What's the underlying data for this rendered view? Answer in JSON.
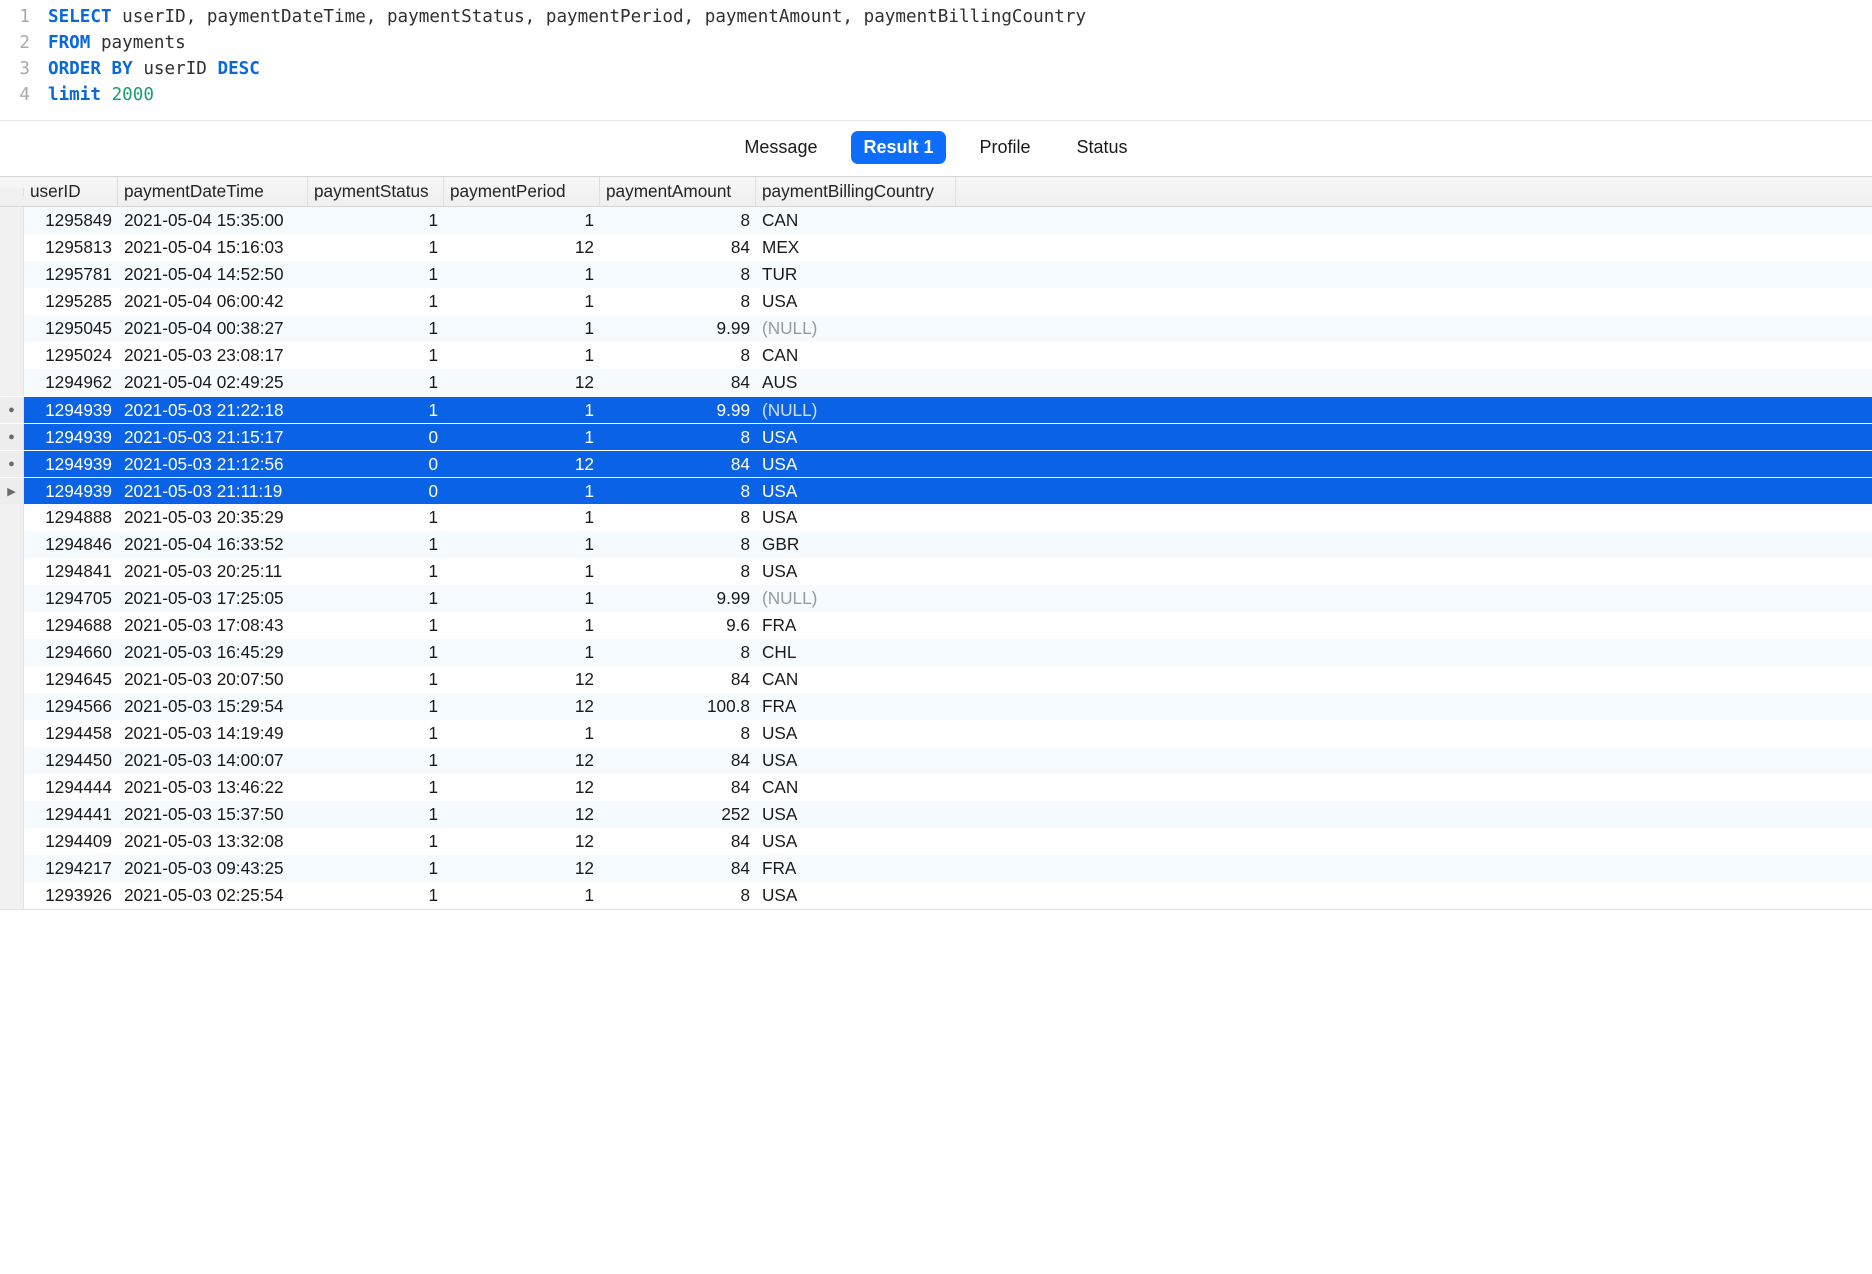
{
  "sql": {
    "lines": [
      {
        "n": "1",
        "tokens": [
          {
            "t": "SELECT",
            "c": "kw"
          },
          {
            "t": " ",
            "c": ""
          },
          {
            "t": "userID, paymentDateTime, paymentStatus, paymentPeriod, paymentAmount, paymentBillingCountry",
            "c": "ident"
          }
        ]
      },
      {
        "n": "2",
        "tokens": [
          {
            "t": "FROM",
            "c": "kw"
          },
          {
            "t": " ",
            "c": ""
          },
          {
            "t": "payments",
            "c": "ident"
          }
        ]
      },
      {
        "n": "3",
        "tokens": [
          {
            "t": "ORDER BY",
            "c": "kw"
          },
          {
            "t": " ",
            "c": ""
          },
          {
            "t": "userID ",
            "c": "ident"
          },
          {
            "t": "DESC",
            "c": "kw"
          }
        ]
      },
      {
        "n": "4",
        "tokens": [
          {
            "t": "limit",
            "c": "kw"
          },
          {
            "t": " ",
            "c": ""
          },
          {
            "t": "2000",
            "c": "num"
          }
        ]
      }
    ]
  },
  "tabs": [
    {
      "label": "Message",
      "active": false
    },
    {
      "label": "Result 1",
      "active": true
    },
    {
      "label": "Profile",
      "active": false
    },
    {
      "label": "Status",
      "active": false
    }
  ],
  "columns": [
    "userID",
    "paymentDateTime",
    "paymentStatus",
    "paymentPeriod",
    "paymentAmount",
    "paymentBillingCountry"
  ],
  "null_label": "(NULL)",
  "rows": [
    {
      "mark": "",
      "sel": false,
      "userID": "1295849",
      "dt": "2021-05-04 15:35:00",
      "status": "1",
      "period": "1",
      "amount": "8",
      "country": "CAN"
    },
    {
      "mark": "",
      "sel": false,
      "userID": "1295813",
      "dt": "2021-05-04 15:16:03",
      "status": "1",
      "period": "12",
      "amount": "84",
      "country": "MEX"
    },
    {
      "mark": "",
      "sel": false,
      "userID": "1295781",
      "dt": "2021-05-04 14:52:50",
      "status": "1",
      "period": "1",
      "amount": "8",
      "country": "TUR"
    },
    {
      "mark": "",
      "sel": false,
      "userID": "1295285",
      "dt": "2021-05-04 06:00:42",
      "status": "1",
      "period": "1",
      "amount": "8",
      "country": "USA"
    },
    {
      "mark": "",
      "sel": false,
      "userID": "1295045",
      "dt": "2021-05-04 00:38:27",
      "status": "1",
      "period": "1",
      "amount": "9.99",
      "country": null
    },
    {
      "mark": "",
      "sel": false,
      "userID": "1295024",
      "dt": "2021-05-03 23:08:17",
      "status": "1",
      "period": "1",
      "amount": "8",
      "country": "CAN"
    },
    {
      "mark": "",
      "sel": false,
      "userID": "1294962",
      "dt": "2021-05-04 02:49:25",
      "status": "1",
      "period": "12",
      "amount": "84",
      "country": "AUS"
    },
    {
      "mark": "dot",
      "sel": true,
      "userID": "1294939",
      "dt": "2021-05-03 21:22:18",
      "status": "1",
      "period": "1",
      "amount": "9.99",
      "country": null
    },
    {
      "mark": "dot",
      "sel": true,
      "userID": "1294939",
      "dt": "2021-05-03 21:15:17",
      "status": "0",
      "period": "1",
      "amount": "8",
      "country": "USA"
    },
    {
      "mark": "dot",
      "sel": true,
      "userID": "1294939",
      "dt": "2021-05-03 21:12:56",
      "status": "0",
      "period": "12",
      "amount": "84",
      "country": "USA"
    },
    {
      "mark": "tri",
      "sel": true,
      "userID": "1294939",
      "dt": "2021-05-03 21:11:19",
      "status": "0",
      "period": "1",
      "amount": "8",
      "country": "USA"
    },
    {
      "mark": "",
      "sel": false,
      "userID": "1294888",
      "dt": "2021-05-03 20:35:29",
      "status": "1",
      "period": "1",
      "amount": "8",
      "country": "USA"
    },
    {
      "mark": "",
      "sel": false,
      "userID": "1294846",
      "dt": "2021-05-04 16:33:52",
      "status": "1",
      "period": "1",
      "amount": "8",
      "country": "GBR"
    },
    {
      "mark": "",
      "sel": false,
      "userID": "1294841",
      "dt": "2021-05-03 20:25:11",
      "status": "1",
      "period": "1",
      "amount": "8",
      "country": "USA"
    },
    {
      "mark": "",
      "sel": false,
      "userID": "1294705",
      "dt": "2021-05-03 17:25:05",
      "status": "1",
      "period": "1",
      "amount": "9.99",
      "country": null
    },
    {
      "mark": "",
      "sel": false,
      "userID": "1294688",
      "dt": "2021-05-03 17:08:43",
      "status": "1",
      "period": "1",
      "amount": "9.6",
      "country": "FRA"
    },
    {
      "mark": "",
      "sel": false,
      "userID": "1294660",
      "dt": "2021-05-03 16:45:29",
      "status": "1",
      "period": "1",
      "amount": "8",
      "country": "CHL"
    },
    {
      "mark": "",
      "sel": false,
      "userID": "1294645",
      "dt": "2021-05-03 20:07:50",
      "status": "1",
      "period": "12",
      "amount": "84",
      "country": "CAN"
    },
    {
      "mark": "",
      "sel": false,
      "userID": "1294566",
      "dt": "2021-05-03 15:29:54",
      "status": "1",
      "period": "12",
      "amount": "100.8",
      "country": "FRA"
    },
    {
      "mark": "",
      "sel": false,
      "userID": "1294458",
      "dt": "2021-05-03 14:19:49",
      "status": "1",
      "period": "1",
      "amount": "8",
      "country": "USA"
    },
    {
      "mark": "",
      "sel": false,
      "userID": "1294450",
      "dt": "2021-05-03 14:00:07",
      "status": "1",
      "period": "12",
      "amount": "84",
      "country": "USA"
    },
    {
      "mark": "",
      "sel": false,
      "userID": "1294444",
      "dt": "2021-05-03 13:46:22",
      "status": "1",
      "period": "12",
      "amount": "84",
      "country": "CAN"
    },
    {
      "mark": "",
      "sel": false,
      "userID": "1294441",
      "dt": "2021-05-03 15:37:50",
      "status": "1",
      "period": "12",
      "amount": "252",
      "country": "USA"
    },
    {
      "mark": "",
      "sel": false,
      "userID": "1294409",
      "dt": "2021-05-03 13:32:08",
      "status": "1",
      "period": "12",
      "amount": "84",
      "country": "USA"
    },
    {
      "mark": "",
      "sel": false,
      "userID": "1294217",
      "dt": "2021-05-03 09:43:25",
      "status": "1",
      "period": "12",
      "amount": "84",
      "country": "FRA"
    },
    {
      "mark": "",
      "sel": false,
      "userID": "1293926",
      "dt": "2021-05-03 02:25:54",
      "status": "1",
      "period": "1",
      "amount": "8",
      "country": "USA"
    }
  ]
}
